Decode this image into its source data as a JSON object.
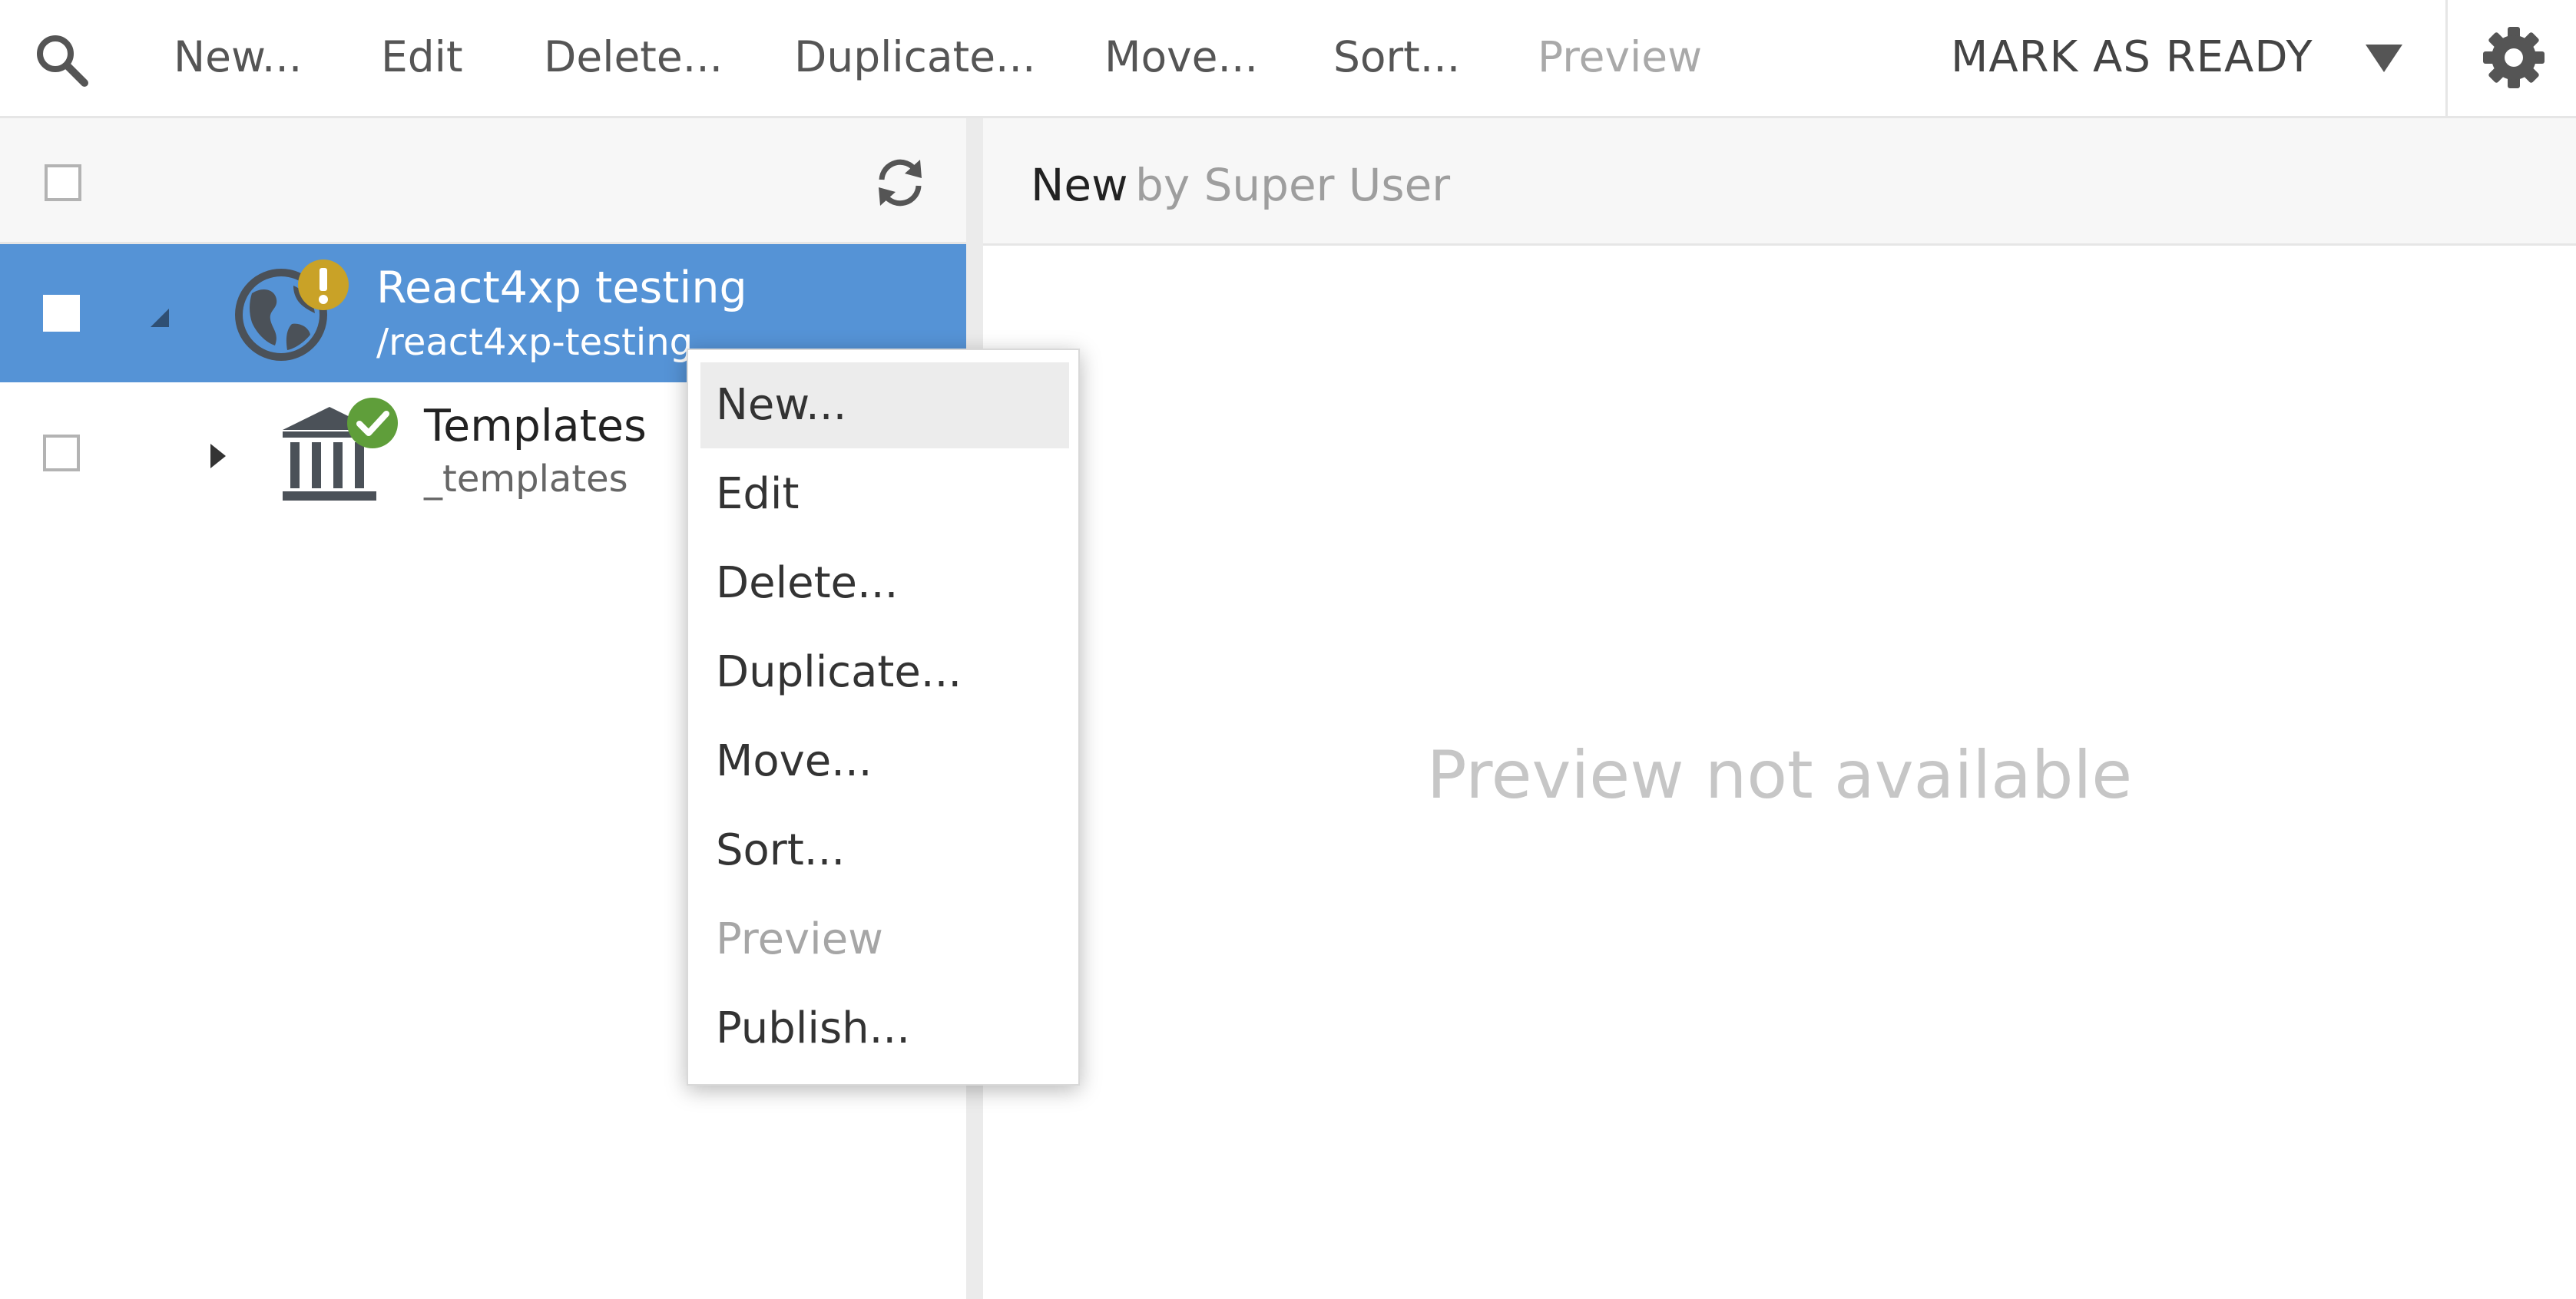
{
  "toolbar": {
    "actions": [
      {
        "label": "New...",
        "enabled": true
      },
      {
        "label": "Edit",
        "enabled": true
      },
      {
        "label": "Delete...",
        "enabled": true
      },
      {
        "label": "Duplicate...",
        "enabled": true
      },
      {
        "label": "Move...",
        "enabled": true
      },
      {
        "label": "Sort...",
        "enabled": true
      },
      {
        "label": "Preview",
        "enabled": false
      }
    ],
    "mark_as_ready_label": "MARK AS READY",
    "icons": {
      "search": "search-icon",
      "dropdown": "chevron-down-icon",
      "settings": "gear-icon"
    }
  },
  "tree": {
    "header_icons": {
      "refresh": "refresh-icon"
    },
    "items": [
      {
        "title": "React4xp testing",
        "path": "/react4xp-testing",
        "selected": true,
        "expanded": true,
        "icon": "globe-icon",
        "status": "warning"
      },
      {
        "title": "Templates",
        "path": "_templates",
        "selected": false,
        "expanded": false,
        "icon": "templates-icon",
        "status": "ok"
      }
    ]
  },
  "preview": {
    "title": "New",
    "subtitle": "by Super User",
    "empty_message": "Preview not available"
  },
  "context_menu": {
    "items": [
      {
        "label": "New...",
        "enabled": true,
        "hovered": true
      },
      {
        "label": "Edit",
        "enabled": true
      },
      {
        "label": "Delete...",
        "enabled": true
      },
      {
        "label": "Duplicate...",
        "enabled": true
      },
      {
        "label": "Move...",
        "enabled": true
      },
      {
        "label": "Sort...",
        "enabled": true
      },
      {
        "label": "Preview",
        "enabled": false
      },
      {
        "label": "Publish...",
        "enabled": true
      }
    ]
  },
  "colors": {
    "selection": "#5593d6",
    "warning_badge": "#c9a227",
    "ok_badge": "#5f9e3a",
    "icon_dark": "#4b5158"
  }
}
